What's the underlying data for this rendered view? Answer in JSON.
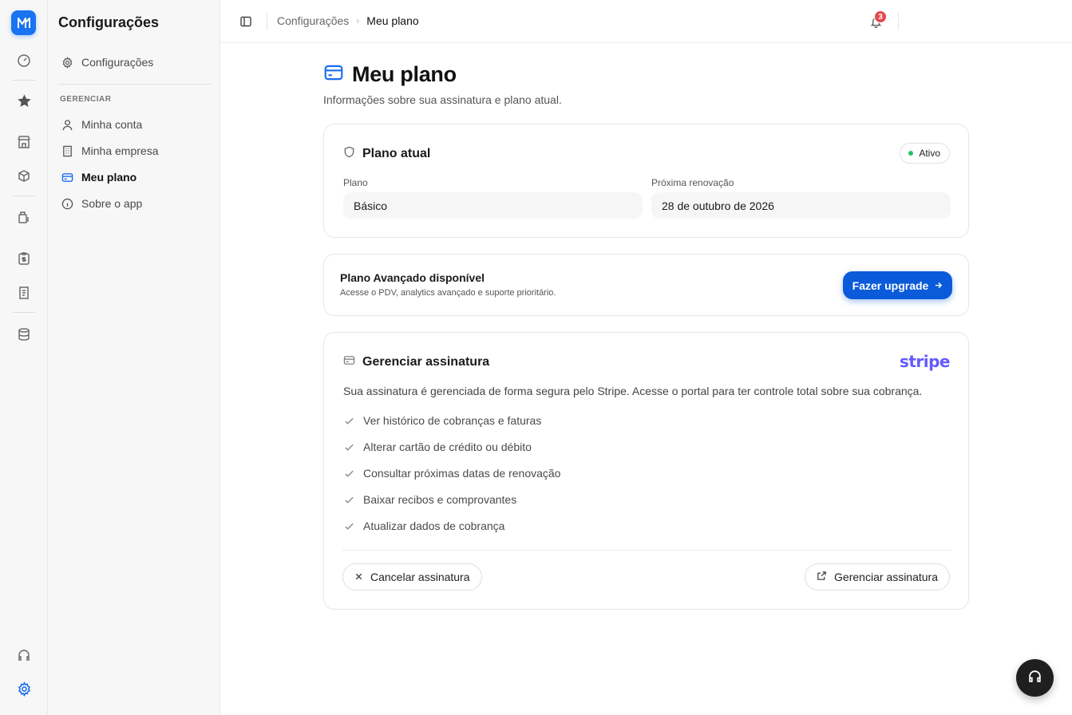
{
  "colors": {
    "accent": "#1a6ff0",
    "primary_button": "#0b5ad9",
    "success": "#22c55e",
    "badge": "#e5484d",
    "stripe": "#635bff"
  },
  "rail": {
    "items": [
      "logo-icon",
      "dashboard-icon",
      "star-icon",
      "store-icon",
      "box-icon",
      "finance-icon",
      "clipboard-dollar-icon",
      "receipt-icon",
      "database-icon",
      "headset-icon",
      "settings-icon"
    ]
  },
  "nav": {
    "title": "Configurações",
    "top_item": "Configurações",
    "section": "GERENCIAR",
    "items": [
      {
        "label": "Minha conta",
        "icon": "user-icon"
      },
      {
        "label": "Minha empresa",
        "icon": "building-icon"
      },
      {
        "label": "Meu plano",
        "icon": "credit-card-icon"
      },
      {
        "label": "Sobre o app",
        "icon": "info-icon"
      }
    ]
  },
  "header": {
    "breadcrumb_parent": "Configurações",
    "breadcrumb_current": "Meu plano",
    "notifications_count": "3"
  },
  "page": {
    "title": "Meu plano",
    "subtitle": "Informações sobre sua assinatura e plano atual."
  },
  "current_plan": {
    "title": "Plano atual",
    "status": "Ativo",
    "plan_label": "Plano",
    "plan_value": "Básico",
    "renewal_label": "Próxima renovação",
    "renewal_value": "28 de outubro de 2026"
  },
  "upgrade": {
    "title": "Plano Avançado disponível",
    "description": "Acesse o PDV, analytics avançado e suporte prioritário.",
    "button": "Fazer upgrade"
  },
  "subscription": {
    "title": "Gerenciar assinatura",
    "provider": "stripe",
    "description": "Sua assinatura é gerenciada de forma segura pelo Stripe. Acesse o portal para ter controle total sobre sua cobrança.",
    "features": [
      "Ver histórico de cobranças e faturas",
      "Alterar cartão de crédito ou débito",
      "Consultar próximas datas de renovação",
      "Baixar recibos e comprovantes",
      "Atualizar dados de cobrança"
    ],
    "cancel_button": "Cancelar assinatura",
    "manage_button": "Gerenciar assinatura"
  }
}
